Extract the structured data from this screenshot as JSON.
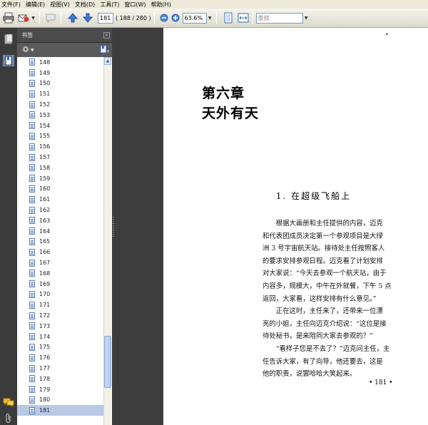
{
  "menubar": {
    "items": [
      "文件(F)",
      "编辑(E)",
      "视图(V)",
      "文档(D)",
      "工具(T)",
      "窗口(W)",
      "帮助(H)"
    ]
  },
  "toolbar": {
    "page_input": "181",
    "page_total": "( 188 / 280 )",
    "zoom": "63.6%",
    "search_placeholder": "查找"
  },
  "panel": {
    "title": "书签"
  },
  "bookmarks": [
    "148",
    "149",
    "150",
    "151",
    "152",
    "153",
    "154",
    "155",
    "156",
    "157",
    "158",
    "159",
    "160",
    "161",
    "162",
    "163",
    "164",
    "165",
    "166",
    "167",
    "168",
    "169",
    "170",
    "171",
    "172",
    "173",
    "174",
    "175",
    "176",
    "177",
    "178",
    "179",
    "180",
    "181"
  ],
  "selected_bookmark": "181",
  "document": {
    "corner_mark": "•",
    "chapter_line1": "第六章",
    "chapter_line2": "天外有天",
    "section_title": "1. 在超级飞船上",
    "lines": [
      "　　根据大画册和主任提供的内容，迈克",
      "和代表团成员决定第一个参观项目是大绿",
      "洲 3 号宇宙航天站。接待处主任按照客人",
      "的要求安排参观日程。迈克看了计划安排",
      "对大家说：“今天去参观一个航天站，由于",
      "内容多，规模大，中午在外就餐，下午 5 点",
      "返回，大家看，这样安排有什么意见。”",
      "　　正在这时，主任来了，还带来一位漂",
      "亮的小姐，主任向迈克介绍说：“这位是接",
      "待处秘书，是来陪同大家去参观的？”",
      "　　“看样子您是不去了？”迈克问主任，主",
      "任告诉大家，有了向导，他还要去，这是",
      "他的职责，说罢哈哈大笑起来。"
    ],
    "page_number": "• 181 •"
  }
}
